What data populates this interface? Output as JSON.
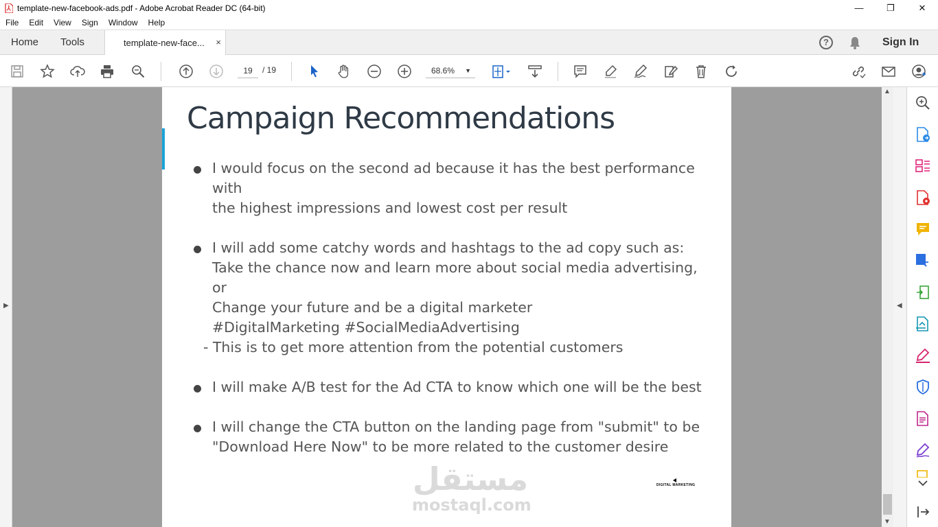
{
  "window": {
    "title": "template-new-facebook-ads.pdf - Adobe Acrobat Reader DC (64-bit)",
    "minimize": "—",
    "restore": "❐",
    "close": "✕"
  },
  "menu": [
    "File",
    "Edit",
    "View",
    "Sign",
    "Window",
    "Help"
  ],
  "tabs": {
    "home": "Home",
    "tools": "Tools",
    "document": "template-new-face...",
    "close": "×",
    "help": "?",
    "sign_in": "Sign In"
  },
  "toolbar": {
    "page_current": "19",
    "page_total": "/  19",
    "zoom": "68.6%"
  },
  "document": {
    "title": "Campaign Recommendations",
    "bullets": [
      {
        "lines": [
          "I would focus on the second ad because it has the best performance with",
          "the highest impressions and lowest cost per result"
        ]
      },
      {
        "lines": [
          "I will add some catchy words and hashtags to the ad copy such as:",
          "Take the chance now and learn more about social media advertising, or",
          "Change your future and be a digital marketer",
          "#DigitalMarketing #SocialMediaAdvertising"
        ],
        "note": "- This is to get more attention from the potential customers"
      },
      {
        "lines": [
          "I will make A/B test for the Ad CTA to know which one will be the best"
        ]
      },
      {
        "lines": [
          "I will change the CTA button on the landing page from \"submit\" to be",
          "\"Download Here Now\" to be more related to the customer desire"
        ]
      }
    ],
    "logo_text": "DIGITAL MARKETING"
  },
  "watermark": {
    "arabic": "مستقل",
    "latin": "mostaql.com"
  },
  "accent_color": "#1ba3d6",
  "icons": [
    "pdf-icon",
    "save-icon",
    "star-icon",
    "upload-icon",
    "print-icon",
    "search-icon",
    "page-up-icon",
    "page-down-icon",
    "pointer-icon",
    "hand-icon",
    "zoom-out-icon",
    "zoom-in-icon",
    "fit-page-icon",
    "scroll-mode-icon",
    "comment-icon",
    "highlight-icon",
    "draw-icon",
    "fill-sign-icon",
    "delete-icon",
    "rotate-icon",
    "link-icon",
    "mail-icon",
    "share-user-icon"
  ]
}
